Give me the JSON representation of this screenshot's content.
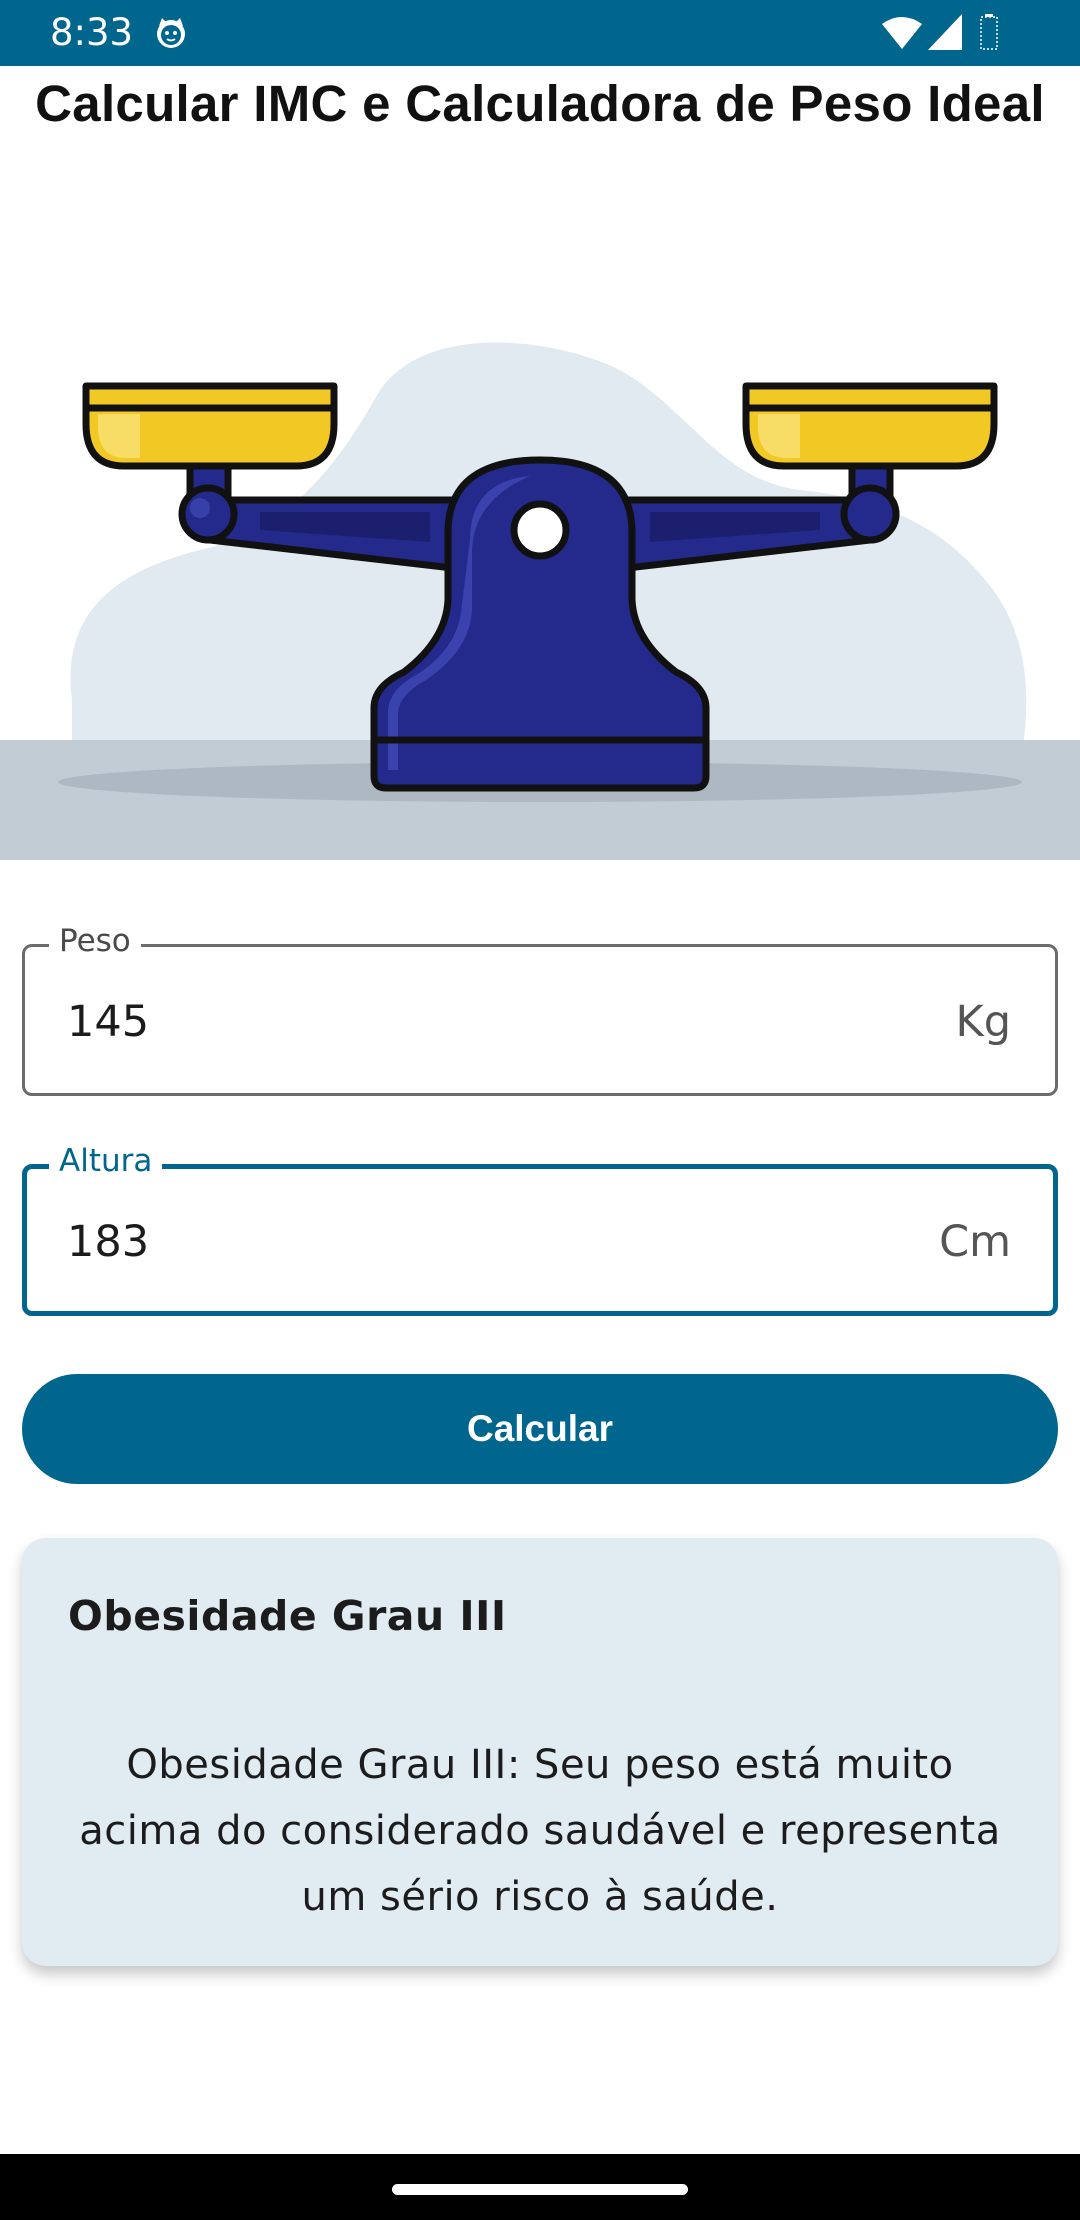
{
  "status_bar": {
    "time": "8:33",
    "icons": [
      "cat-notification-icon",
      "wifi-icon",
      "signal-icon",
      "battery-icon"
    ],
    "background": "#00668e"
  },
  "page": {
    "title": "Calcular IMC e Calculadora de Peso Ideal"
  },
  "illustration": {
    "icon": "balance-scale-icon",
    "colors": {
      "scale": "#232a8c",
      "pans": "#f2c924",
      "blob": "#e1e9f1",
      "floor": "#c2ccd4"
    }
  },
  "form": {
    "weight": {
      "label": "Peso",
      "value": "145",
      "suffix": "Kg"
    },
    "height": {
      "label": "Altura",
      "value": "183",
      "suffix": "Cm",
      "focused": true
    },
    "calculate_label": "Calcular",
    "accent": "#00668e"
  },
  "result": {
    "title": "Obesidade Grau III",
    "description": "Obesidade Grau III: Seu peso está muito acima do considerado saudável e representa um sério risco à saúde.",
    "background": "#e1ebf2"
  }
}
